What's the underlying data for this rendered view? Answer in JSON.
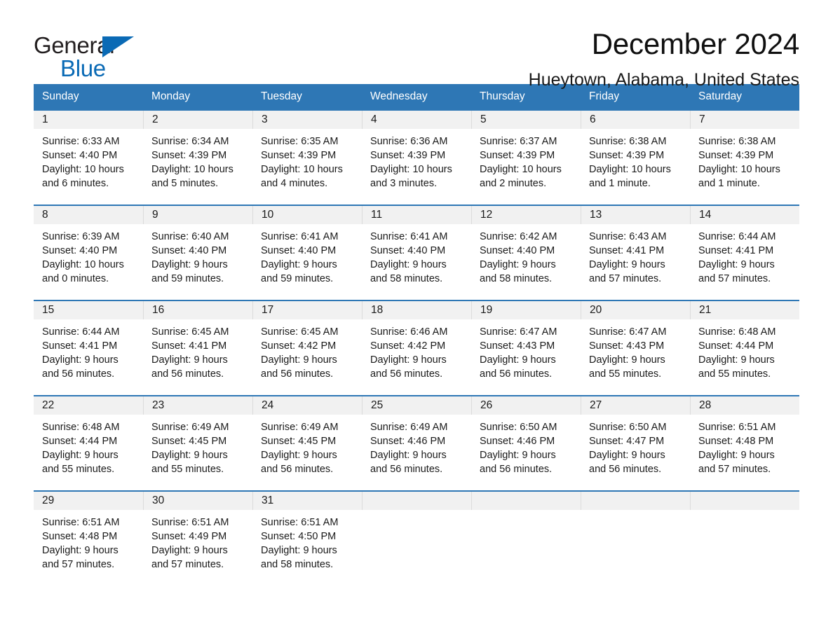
{
  "brand": {
    "name_part1": "General",
    "name_part2": "Blue",
    "triangle_icon": "blue-triangle-icon",
    "color_dark": "#231f20",
    "color_blue": "#0a6ab5"
  },
  "header": {
    "title": "December 2024",
    "subtitle": "Hueytown, Alabama, United States"
  },
  "theme": {
    "header_blue": "#2e77b5",
    "daynum_band": "#f1f1f1",
    "cell_divider": "#dcdcdc"
  },
  "calendar": {
    "weekdays": [
      "Sunday",
      "Monday",
      "Tuesday",
      "Wednesday",
      "Thursday",
      "Friday",
      "Saturday"
    ],
    "labels": {
      "sunrise": "Sunrise:",
      "sunset": "Sunset:",
      "daylight": "Daylight:"
    },
    "weeks": [
      {
        "days": [
          {
            "num": "1",
            "sunrise": "Sunrise: 6:33 AM",
            "sunset": "Sunset: 4:40 PM",
            "daylight_1": "Daylight: 10 hours",
            "daylight_2": "and 6 minutes."
          },
          {
            "num": "2",
            "sunrise": "Sunrise: 6:34 AM",
            "sunset": "Sunset: 4:39 PM",
            "daylight_1": "Daylight: 10 hours",
            "daylight_2": "and 5 minutes."
          },
          {
            "num": "3",
            "sunrise": "Sunrise: 6:35 AM",
            "sunset": "Sunset: 4:39 PM",
            "daylight_1": "Daylight: 10 hours",
            "daylight_2": "and 4 minutes."
          },
          {
            "num": "4",
            "sunrise": "Sunrise: 6:36 AM",
            "sunset": "Sunset: 4:39 PM",
            "daylight_1": "Daylight: 10 hours",
            "daylight_2": "and 3 minutes."
          },
          {
            "num": "5",
            "sunrise": "Sunrise: 6:37 AM",
            "sunset": "Sunset: 4:39 PM",
            "daylight_1": "Daylight: 10 hours",
            "daylight_2": "and 2 minutes."
          },
          {
            "num": "6",
            "sunrise": "Sunrise: 6:38 AM",
            "sunset": "Sunset: 4:39 PM",
            "daylight_1": "Daylight: 10 hours",
            "daylight_2": "and 1 minute."
          },
          {
            "num": "7",
            "sunrise": "Sunrise: 6:38 AM",
            "sunset": "Sunset: 4:39 PM",
            "daylight_1": "Daylight: 10 hours",
            "daylight_2": "and 1 minute."
          }
        ]
      },
      {
        "days": [
          {
            "num": "8",
            "sunrise": "Sunrise: 6:39 AM",
            "sunset": "Sunset: 4:40 PM",
            "daylight_1": "Daylight: 10 hours",
            "daylight_2": "and 0 minutes."
          },
          {
            "num": "9",
            "sunrise": "Sunrise: 6:40 AM",
            "sunset": "Sunset: 4:40 PM",
            "daylight_1": "Daylight: 9 hours",
            "daylight_2": "and 59 minutes."
          },
          {
            "num": "10",
            "sunrise": "Sunrise: 6:41 AM",
            "sunset": "Sunset: 4:40 PM",
            "daylight_1": "Daylight: 9 hours",
            "daylight_2": "and 59 minutes."
          },
          {
            "num": "11",
            "sunrise": "Sunrise: 6:41 AM",
            "sunset": "Sunset: 4:40 PM",
            "daylight_1": "Daylight: 9 hours",
            "daylight_2": "and 58 minutes."
          },
          {
            "num": "12",
            "sunrise": "Sunrise: 6:42 AM",
            "sunset": "Sunset: 4:40 PM",
            "daylight_1": "Daylight: 9 hours",
            "daylight_2": "and 58 minutes."
          },
          {
            "num": "13",
            "sunrise": "Sunrise: 6:43 AM",
            "sunset": "Sunset: 4:41 PM",
            "daylight_1": "Daylight: 9 hours",
            "daylight_2": "and 57 minutes."
          },
          {
            "num": "14",
            "sunrise": "Sunrise: 6:44 AM",
            "sunset": "Sunset: 4:41 PM",
            "daylight_1": "Daylight: 9 hours",
            "daylight_2": "and 57 minutes."
          }
        ]
      },
      {
        "days": [
          {
            "num": "15",
            "sunrise": "Sunrise: 6:44 AM",
            "sunset": "Sunset: 4:41 PM",
            "daylight_1": "Daylight: 9 hours",
            "daylight_2": "and 56 minutes."
          },
          {
            "num": "16",
            "sunrise": "Sunrise: 6:45 AM",
            "sunset": "Sunset: 4:41 PM",
            "daylight_1": "Daylight: 9 hours",
            "daylight_2": "and 56 minutes."
          },
          {
            "num": "17",
            "sunrise": "Sunrise: 6:45 AM",
            "sunset": "Sunset: 4:42 PM",
            "daylight_1": "Daylight: 9 hours",
            "daylight_2": "and 56 minutes."
          },
          {
            "num": "18",
            "sunrise": "Sunrise: 6:46 AM",
            "sunset": "Sunset: 4:42 PM",
            "daylight_1": "Daylight: 9 hours",
            "daylight_2": "and 56 minutes."
          },
          {
            "num": "19",
            "sunrise": "Sunrise: 6:47 AM",
            "sunset": "Sunset: 4:43 PM",
            "daylight_1": "Daylight: 9 hours",
            "daylight_2": "and 56 minutes."
          },
          {
            "num": "20",
            "sunrise": "Sunrise: 6:47 AM",
            "sunset": "Sunset: 4:43 PM",
            "daylight_1": "Daylight: 9 hours",
            "daylight_2": "and 55 minutes."
          },
          {
            "num": "21",
            "sunrise": "Sunrise: 6:48 AM",
            "sunset": "Sunset: 4:44 PM",
            "daylight_1": "Daylight: 9 hours",
            "daylight_2": "and 55 minutes."
          }
        ]
      },
      {
        "days": [
          {
            "num": "22",
            "sunrise": "Sunrise: 6:48 AM",
            "sunset": "Sunset: 4:44 PM",
            "daylight_1": "Daylight: 9 hours",
            "daylight_2": "and 55 minutes."
          },
          {
            "num": "23",
            "sunrise": "Sunrise: 6:49 AM",
            "sunset": "Sunset: 4:45 PM",
            "daylight_1": "Daylight: 9 hours",
            "daylight_2": "and 55 minutes."
          },
          {
            "num": "24",
            "sunrise": "Sunrise: 6:49 AM",
            "sunset": "Sunset: 4:45 PM",
            "daylight_1": "Daylight: 9 hours",
            "daylight_2": "and 56 minutes."
          },
          {
            "num": "25",
            "sunrise": "Sunrise: 6:49 AM",
            "sunset": "Sunset: 4:46 PM",
            "daylight_1": "Daylight: 9 hours",
            "daylight_2": "and 56 minutes."
          },
          {
            "num": "26",
            "sunrise": "Sunrise: 6:50 AM",
            "sunset": "Sunset: 4:46 PM",
            "daylight_1": "Daylight: 9 hours",
            "daylight_2": "and 56 minutes."
          },
          {
            "num": "27",
            "sunrise": "Sunrise: 6:50 AM",
            "sunset": "Sunset: 4:47 PM",
            "daylight_1": "Daylight: 9 hours",
            "daylight_2": "and 56 minutes."
          },
          {
            "num": "28",
            "sunrise": "Sunrise: 6:51 AM",
            "sunset": "Sunset: 4:48 PM",
            "daylight_1": "Daylight: 9 hours",
            "daylight_2": "and 57 minutes."
          }
        ]
      },
      {
        "days": [
          {
            "num": "29",
            "sunrise": "Sunrise: 6:51 AM",
            "sunset": "Sunset: 4:48 PM",
            "daylight_1": "Daylight: 9 hours",
            "daylight_2": "and 57 minutes."
          },
          {
            "num": "30",
            "sunrise": "Sunrise: 6:51 AM",
            "sunset": "Sunset: 4:49 PM",
            "daylight_1": "Daylight: 9 hours",
            "daylight_2": "and 57 minutes."
          },
          {
            "num": "31",
            "sunrise": "Sunrise: 6:51 AM",
            "sunset": "Sunset: 4:50 PM",
            "daylight_1": "Daylight: 9 hours",
            "daylight_2": "and 58 minutes."
          },
          {
            "num": "",
            "sunrise": "",
            "sunset": "",
            "daylight_1": "",
            "daylight_2": "",
            "empty": true
          },
          {
            "num": "",
            "sunrise": "",
            "sunset": "",
            "daylight_1": "",
            "daylight_2": "",
            "empty": true
          },
          {
            "num": "",
            "sunrise": "",
            "sunset": "",
            "daylight_1": "",
            "daylight_2": "",
            "empty": true
          },
          {
            "num": "",
            "sunrise": "",
            "sunset": "",
            "daylight_1": "",
            "daylight_2": "",
            "empty": true
          }
        ]
      }
    ]
  }
}
